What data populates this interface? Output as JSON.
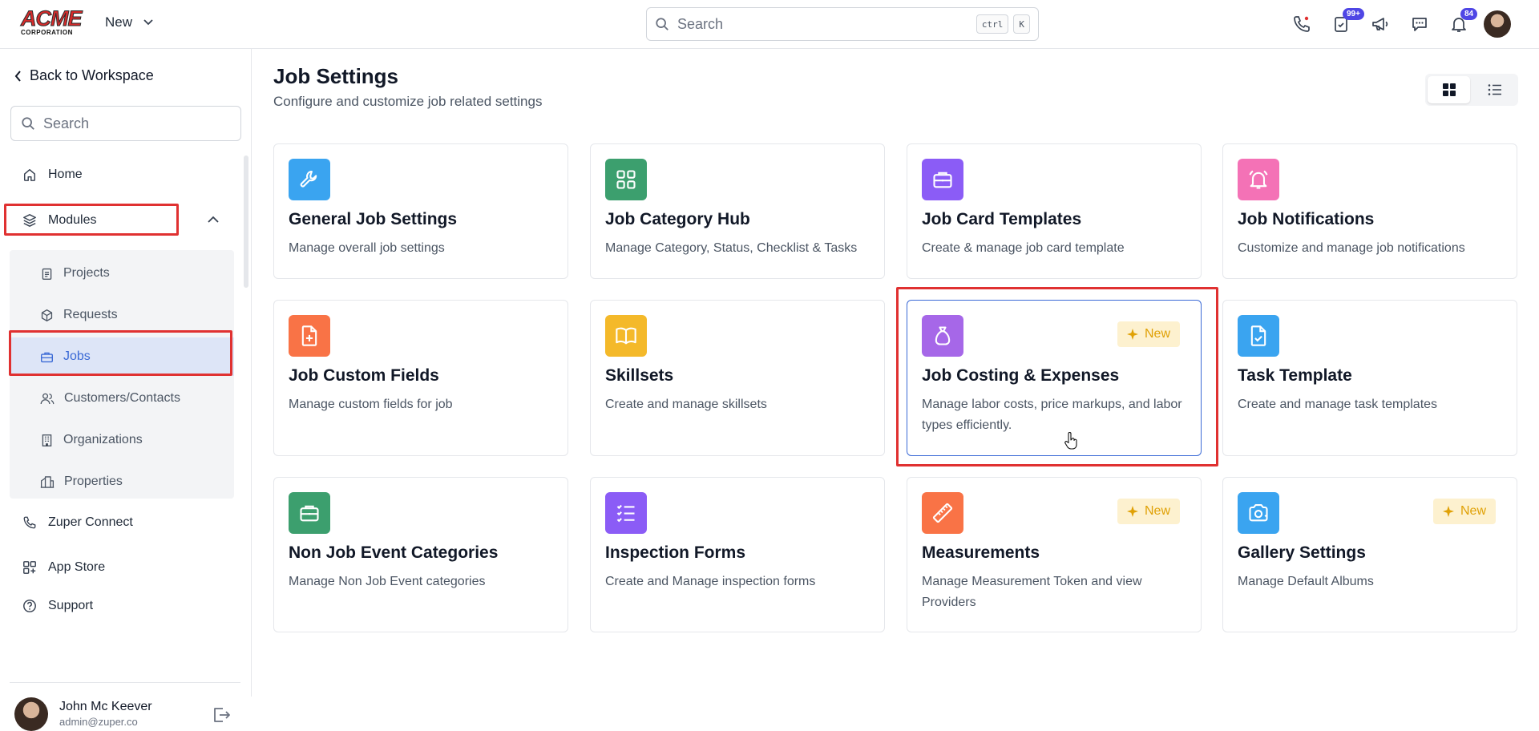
{
  "header": {
    "logo_text": "ACME",
    "logo_subtext": "CORPORATION",
    "new_label": "New",
    "search_placeholder": "Search",
    "kbd_ctrl": "ctrl",
    "kbd_k": "K",
    "tasks_badge": "99+",
    "notifications_badge": "84"
  },
  "sidebar": {
    "back_label": "Back to Workspace",
    "search_placeholder": "Search",
    "home": "Home",
    "modules": "Modules",
    "modules_items": [
      {
        "label": "Projects"
      },
      {
        "label": "Requests"
      },
      {
        "label": "Jobs"
      },
      {
        "label": "Customers/Contacts"
      },
      {
        "label": "Organizations"
      },
      {
        "label": "Properties"
      }
    ],
    "zuper_connect": "Zuper Connect",
    "app_store": "App Store",
    "support": "Support",
    "user": {
      "name": "John Mc Keever",
      "email": "admin@zuper.co"
    }
  },
  "main": {
    "title": "Job Settings",
    "subtitle": "Configure and customize job related settings",
    "new_badge": "New",
    "cards": [
      {
        "title": "General Job Settings",
        "desc": "Manage overall job settings",
        "icon": "wrench-icon",
        "color": "#3aa4f0"
      },
      {
        "title": "Job Category Hub",
        "desc": "Manage Category, Status, Checklist & Tasks",
        "icon": "grid-icon",
        "color": "#3c9f6e"
      },
      {
        "title": "Job Card Templates",
        "desc": "Create & manage job card template",
        "icon": "briefcase-icon",
        "color": "#8b5cf6"
      },
      {
        "title": "Job Notifications",
        "desc": "Customize and manage job notifications",
        "icon": "bell-icon",
        "color": "#f472b6"
      },
      {
        "title": "Job Custom Fields",
        "desc": "Manage custom fields for job",
        "icon": "file-plus-icon",
        "color": "#f97346"
      },
      {
        "title": "Skillsets",
        "desc": "Create and manage skillsets",
        "icon": "book-icon",
        "color": "#f4b92a"
      },
      {
        "title": "Job Costing & Expenses",
        "desc": "Manage labor costs, price markups, and labor types efficiently.",
        "icon": "money-bag-icon",
        "color": "#a667e8"
      },
      {
        "title": "Task Template",
        "desc": "Create and manage task templates",
        "icon": "file-check-icon",
        "color": "#3aa4f0"
      },
      {
        "title": "Non Job Event Categories",
        "desc": "Manage Non Job Event categories",
        "icon": "briefcase-icon",
        "color": "#3c9f6e"
      },
      {
        "title": "Inspection Forms",
        "desc": "Create and Manage inspection forms",
        "icon": "checklist-icon",
        "color": "#8b5cf6"
      },
      {
        "title": "Measurements",
        "desc": "Manage Measurement Token and view Providers",
        "icon": "ruler-icon",
        "color": "#f97346"
      },
      {
        "title": "Gallery Settings",
        "desc": "Manage Default Albums",
        "icon": "camera-icon",
        "color": "#3aa4f0"
      }
    ]
  }
}
